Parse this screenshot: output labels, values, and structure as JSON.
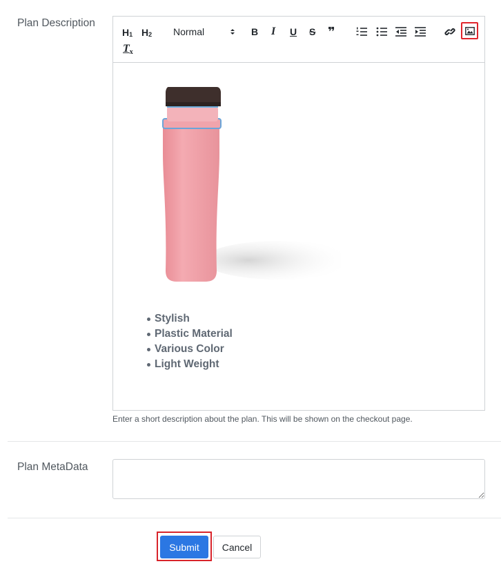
{
  "plan_description": {
    "label": "Plan Description",
    "toolbar": {
      "h1": "H",
      "h1_sub": "1",
      "h2": "H",
      "h2_sub": "2",
      "format_select": "Normal",
      "bold": "B",
      "italic": "I",
      "underline": "U",
      "strike": "S",
      "quote": "❞",
      "clear": "T"
    },
    "bullets": [
      "Stylish",
      "Plastic Material",
      "Various Color",
      "Light Weight"
    ],
    "help_text": "Enter a short description about the plan. This will be shown on the checkout page."
  },
  "plan_metadata": {
    "label": "Plan MetaData",
    "value": ""
  },
  "actions": {
    "submit": "Submit",
    "cancel": "Cancel"
  },
  "colors": {
    "accent": "#2b77e3",
    "highlight": "#e0242b",
    "bottle": "#ef9fa6"
  }
}
